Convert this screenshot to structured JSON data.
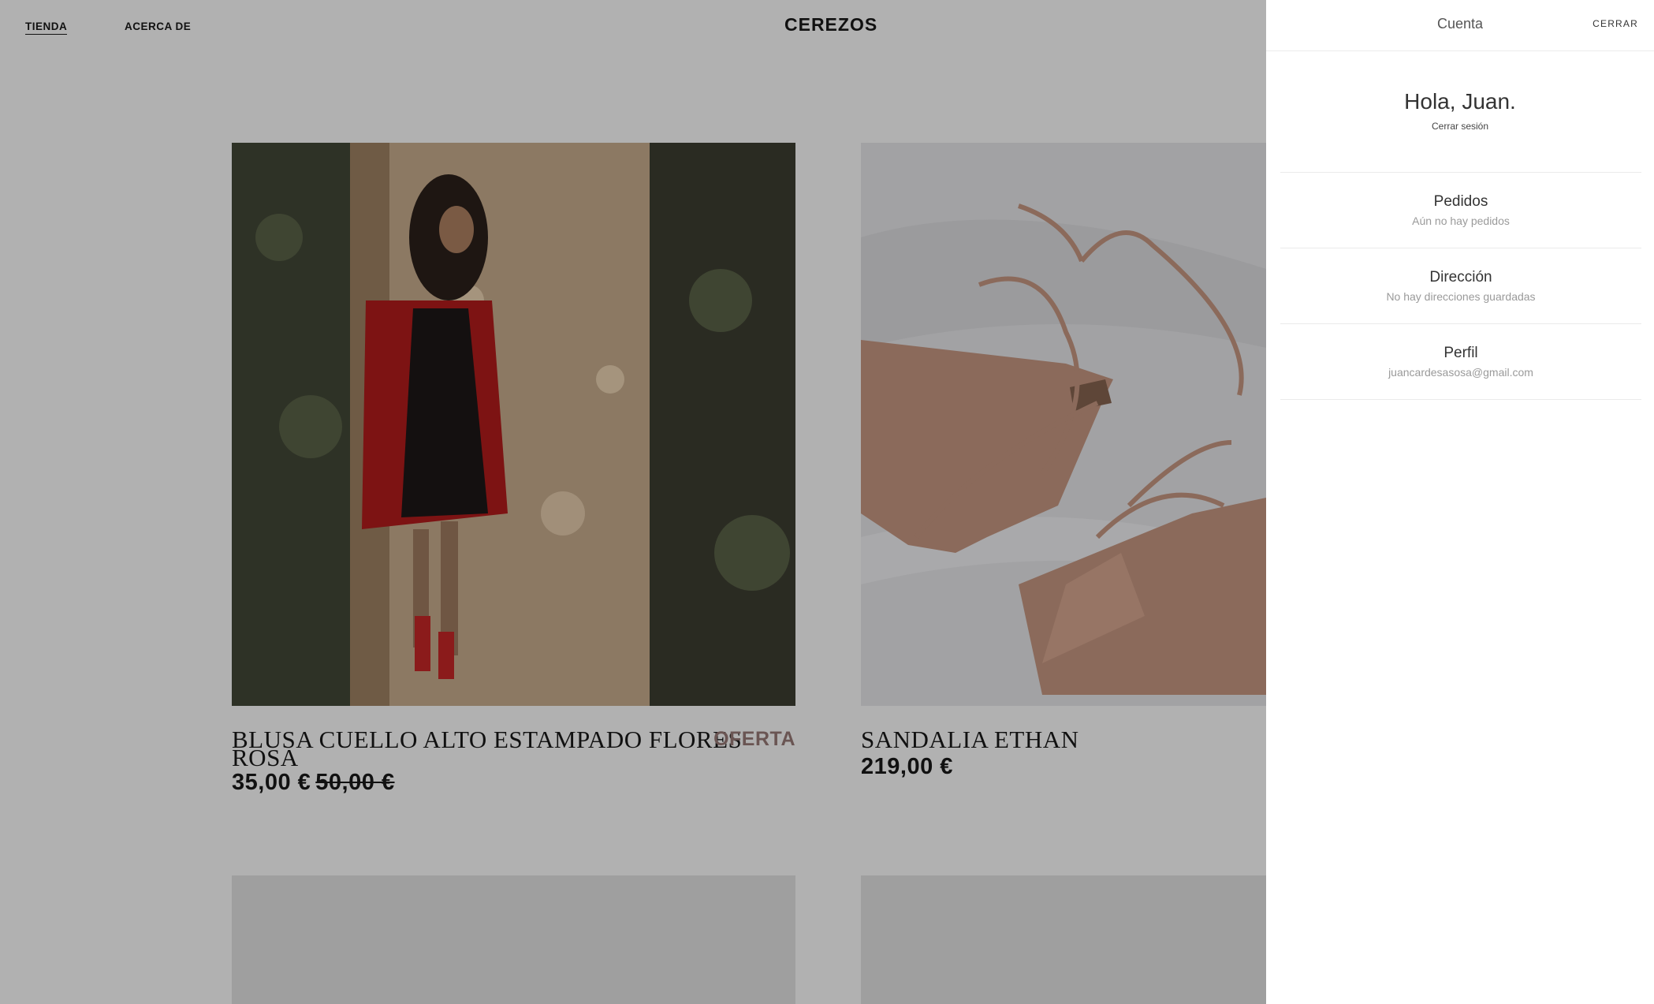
{
  "nav": {
    "shop": "TIENDA",
    "about": "ACERCA DE"
  },
  "brand": "CEREZOS",
  "products": [
    {
      "title": "BLUSA CUELLO ALTO ESTAMPADO FLORES ROSA",
      "badge": "OFERTA",
      "price": "35,00 €",
      "old_price": "50,00 €"
    },
    {
      "title": "SANDALIA ETHAN",
      "price": "219,00 €"
    }
  ],
  "account": {
    "title": "Cuenta",
    "close": "CERRAR",
    "greeting": "Hola, Juan.",
    "logout": "Cerrar sesión",
    "sections": [
      {
        "title": "Pedidos",
        "subtitle": "Aún no hay pedidos"
      },
      {
        "title": "Dirección",
        "subtitle": "No hay direcciones guardadas"
      },
      {
        "title": "Perfil",
        "subtitle": "juancardesasosa@gmail.com"
      }
    ]
  }
}
